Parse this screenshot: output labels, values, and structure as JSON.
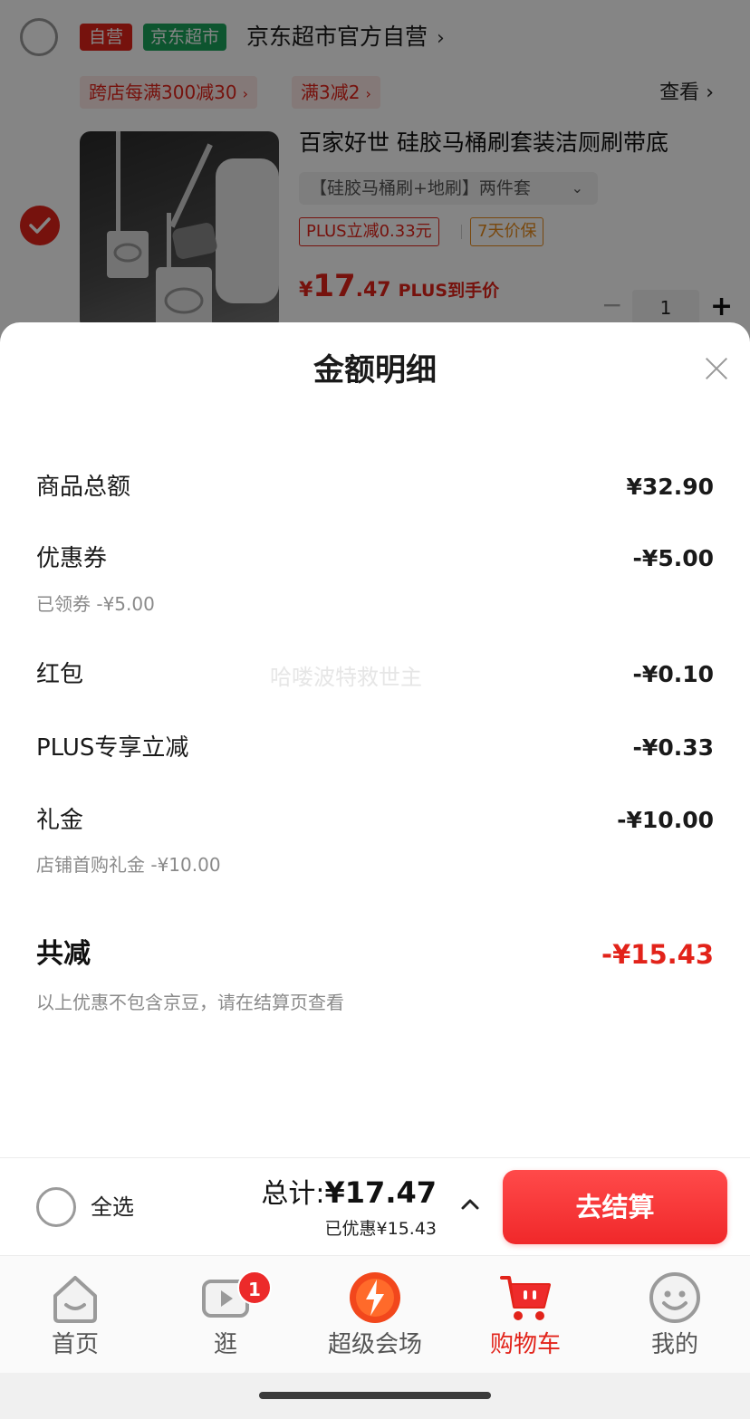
{
  "cart": {
    "shop": {
      "tag_self": "自营",
      "tag_channel": "京东超市",
      "name": "京东超市官方自营",
      "name_chevron": "›"
    },
    "promos": [
      {
        "label": "跨店每满300减30",
        "chevron": "›"
      },
      {
        "label": "满3减2",
        "chevron": "›"
      }
    ],
    "view_more": "查看",
    "view_more_chevron": "›",
    "product": {
      "title": "百家好世 硅胶马桶刷套装洁厕刷带底",
      "variant": "【硅胶马桶刷+地刷】两件套",
      "variant_dropdown": "⌄",
      "tag_plus": "PLUS立减0.33元",
      "tag_guarantee": "7天价保",
      "price_currency": "¥",
      "price_integer": "17",
      "price_decimal": ".47",
      "price_note": "PLUS到手价",
      "qty_minus": "−",
      "quantity": "1",
      "qty_plus": "+",
      "checked": true
    }
  },
  "sheet": {
    "title": "金额明细",
    "rows": {
      "goods_total": {
        "label": "商品总额",
        "value": "¥32.90"
      },
      "coupon": {
        "label": "优惠券",
        "value": "-¥5.00",
        "sub": "已领券 -¥5.00"
      },
      "red_packet": {
        "label": "红包",
        "value": "-¥0.10"
      },
      "plus": {
        "label": "PLUS专享立减",
        "value": "-¥0.33"
      },
      "gift": {
        "label": "礼金",
        "value": "-¥10.00",
        "sub": "店铺首购礼金 -¥10.00"
      }
    },
    "total_reduction": {
      "label": "共减",
      "value": "-¥15.43"
    },
    "note": "以上优惠不包含京豆，请在结算页查看",
    "watermark": "哈喽波特救世主"
  },
  "checkout": {
    "select_all": "全选",
    "total_label": "总计:",
    "total_value": "¥17.47",
    "saved": "已优惠¥15.43",
    "button": "去结算"
  },
  "tabbar": {
    "items": [
      {
        "label": "首页",
        "icon": "home-icon"
      },
      {
        "label": "逛",
        "icon": "video-icon",
        "badge": "1"
      },
      {
        "label": "超级会场",
        "icon": "super-venue-icon"
      },
      {
        "label": "购物车",
        "icon": "cart-icon",
        "active": true
      },
      {
        "label": "我的",
        "icon": "profile-icon"
      }
    ]
  },
  "colors": {
    "brand_red": "#e2231a",
    "channel_green": "#1aa35a",
    "guarantee_orange": "#e88a1a",
    "muted_text": "#8a8a8a"
  }
}
